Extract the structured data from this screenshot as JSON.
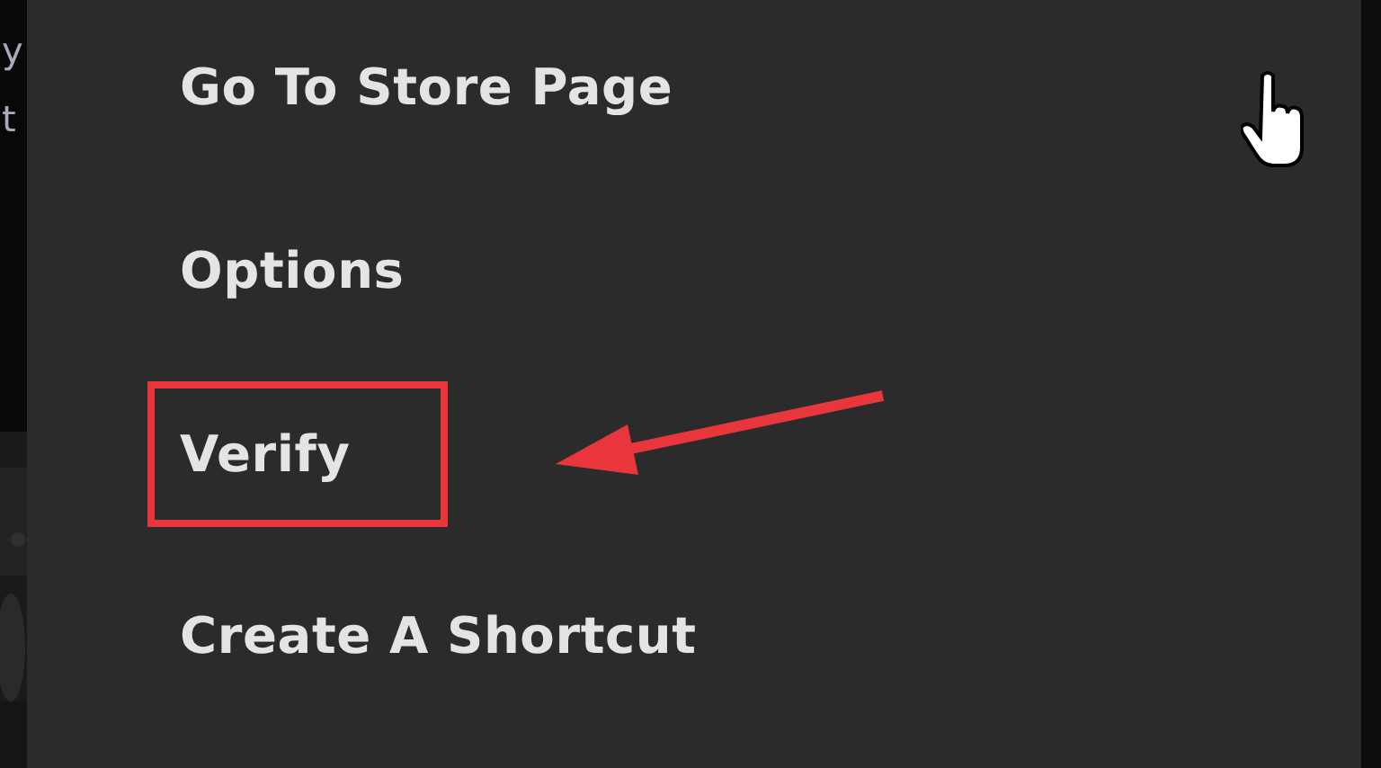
{
  "side_panel": {
    "texts": [
      "y",
      "t"
    ]
  },
  "menu": {
    "items": [
      {
        "label": "Go To Store Page",
        "highlighted": false
      },
      {
        "label": "Options",
        "highlighted": false
      },
      {
        "label": "Verify",
        "highlighted": true
      },
      {
        "label": "Create A Shortcut",
        "highlighted": false
      }
    ]
  }
}
